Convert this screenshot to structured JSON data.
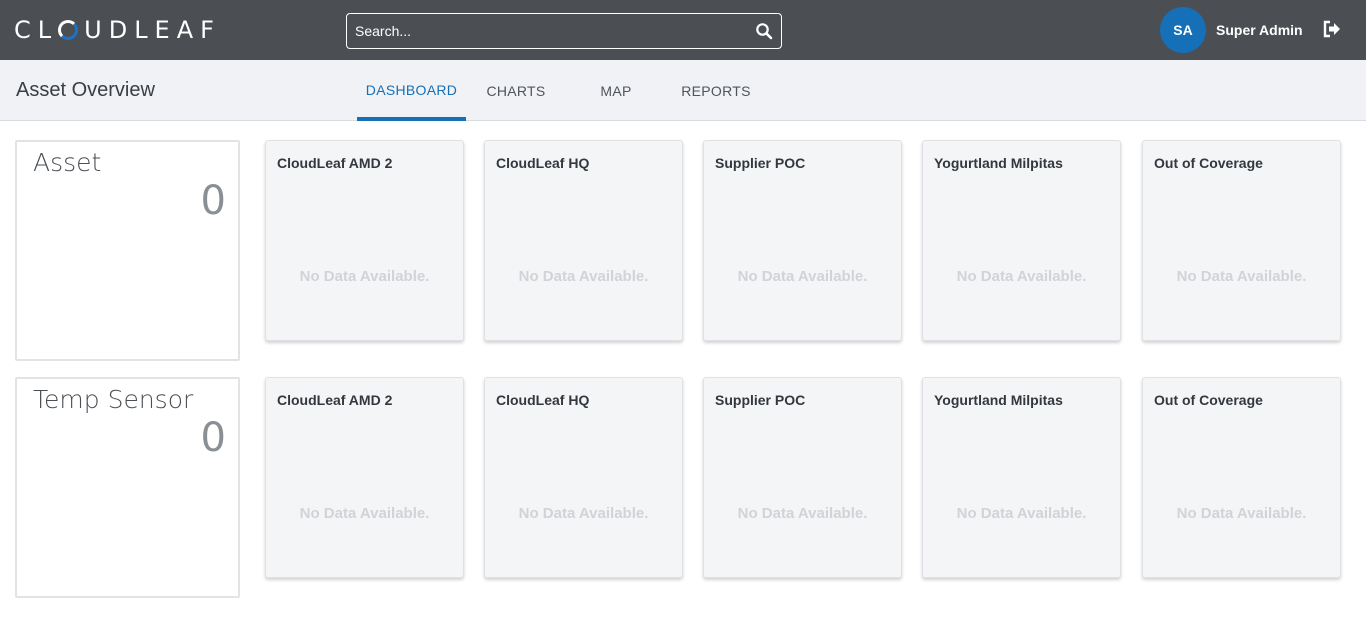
{
  "header": {
    "logo_pre": "CL",
    "logo_post": "UDLEAF",
    "search_placeholder": "Search...",
    "avatar_initials": "SA",
    "user_name": "Super Admin"
  },
  "subheader": {
    "title": "Asset Overview",
    "tabs": [
      {
        "label": "DASHBOARD",
        "active": true
      },
      {
        "label": "CHARTS",
        "active": false
      },
      {
        "label": "MAP",
        "active": false
      },
      {
        "label": "REPORTS",
        "active": false
      }
    ]
  },
  "rows": [
    {
      "summary": {
        "title": "Asset",
        "count": "0"
      },
      "locations": [
        {
          "name": "CloudLeaf AMD 2",
          "status": "No Data Available."
        },
        {
          "name": "CloudLeaf HQ",
          "status": "No Data Available."
        },
        {
          "name": "Supplier POC",
          "status": "No Data Available."
        },
        {
          "name": "Yogurtland Milpitas",
          "status": "No Data Available."
        },
        {
          "name": "Out of Coverage",
          "status": "No Data Available."
        }
      ]
    },
    {
      "summary": {
        "title": "Temp Sensor",
        "count": "0"
      },
      "locations": [
        {
          "name": "CloudLeaf AMD 2",
          "status": "No Data Available."
        },
        {
          "name": "CloudLeaf HQ",
          "status": "No Data Available."
        },
        {
          "name": "Supplier POC",
          "status": "No Data Available."
        },
        {
          "name": "Yogurtland Milpitas",
          "status": "No Data Available."
        },
        {
          "name": "Out of Coverage",
          "status": "No Data Available."
        }
      ]
    }
  ],
  "colors": {
    "topbar": "#4b4e53",
    "accent": "#1670b8",
    "subheader": "#f0f2f5",
    "card": "#f4f5f7"
  }
}
